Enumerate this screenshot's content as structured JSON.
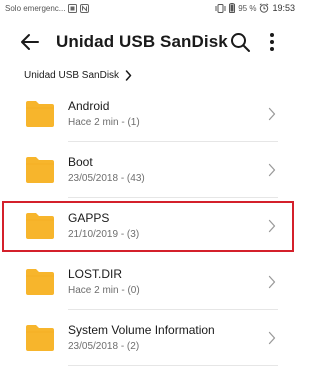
{
  "status_bar": {
    "carrier_text": "Solo emergenc...",
    "battery_percent": "95 %",
    "time": "19:53"
  },
  "app_bar": {
    "title": "Unidad USB SanDisk",
    "back_icon": "arrow-back-icon",
    "search_icon": "search-icon",
    "more_icon": "more-vert-icon"
  },
  "breadcrumb": {
    "label": "Unidad USB SanDisk"
  },
  "colors": {
    "folder": "#F7B52C",
    "highlight_border": "#D4202B",
    "divider": "#E6E6E6"
  },
  "files": [
    {
      "name": "Android",
      "meta": "Hace 2 min - (1)"
    },
    {
      "name": "Boot",
      "meta": "23/05/2018 - (43)"
    },
    {
      "name": "GAPPS",
      "meta": "21/10/2019 - (3)",
      "highlighted": true
    },
    {
      "name": "LOST.DIR",
      "meta": "Hace 2 min - (0)"
    },
    {
      "name": "System Volume Information",
      "meta": "23/05/2018 - (2)"
    }
  ]
}
